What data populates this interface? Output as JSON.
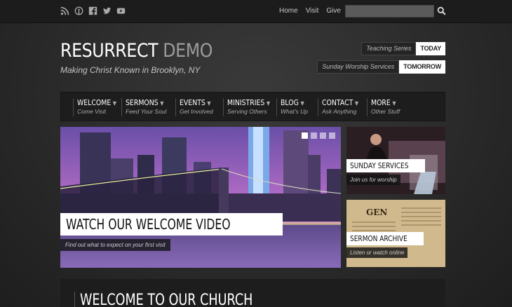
{
  "topbar": {
    "social_icons": [
      "rss-icon",
      "podcast-icon",
      "facebook-icon",
      "twitter-icon",
      "youtube-icon"
    ],
    "links": [
      "Home",
      "Visit",
      "Give"
    ],
    "search_placeholder": ""
  },
  "header": {
    "title_main": "RESURRECT",
    "title_accent": "DEMO",
    "tagline": "Making Christ Known in Brooklyn, NY",
    "schedule": [
      {
        "label": "Teaching Series",
        "button": "TODAY"
      },
      {
        "label": "Sunday Worship Services",
        "button": "TOMORROW"
      }
    ]
  },
  "nav": [
    {
      "title": "WELCOME",
      "sub": "Come Visit"
    },
    {
      "title": "SERMONS",
      "sub": "Feed Your Soul"
    },
    {
      "title": "EVENTS",
      "sub": "Get Involved"
    },
    {
      "title": "MINISTRIES",
      "sub": "Serving Others"
    },
    {
      "title": "BLOG",
      "sub": "What's Up"
    },
    {
      "title": "CONTACT",
      "sub": "Ask Anything"
    },
    {
      "title": "MORE",
      "sub": "Other Stuff"
    }
  ],
  "hero": {
    "title": "WATCH OUR WELCOME VIDEO",
    "subtitle": "Find out what to expect on your first visit",
    "slides": 4,
    "active_slide": 1
  },
  "cards": [
    {
      "title": "SUNDAY SERVICES",
      "sub": "Join us for worship"
    },
    {
      "title": "SERMON ARCHIVE",
      "sub": "Listen or watch online"
    }
  ],
  "welcome": {
    "title": "WELCOME TO OUR CHURCH"
  },
  "colors": {
    "background": "#2c2c2c",
    "nav": "#1d1d1d",
    "accent": "#ffffff"
  }
}
